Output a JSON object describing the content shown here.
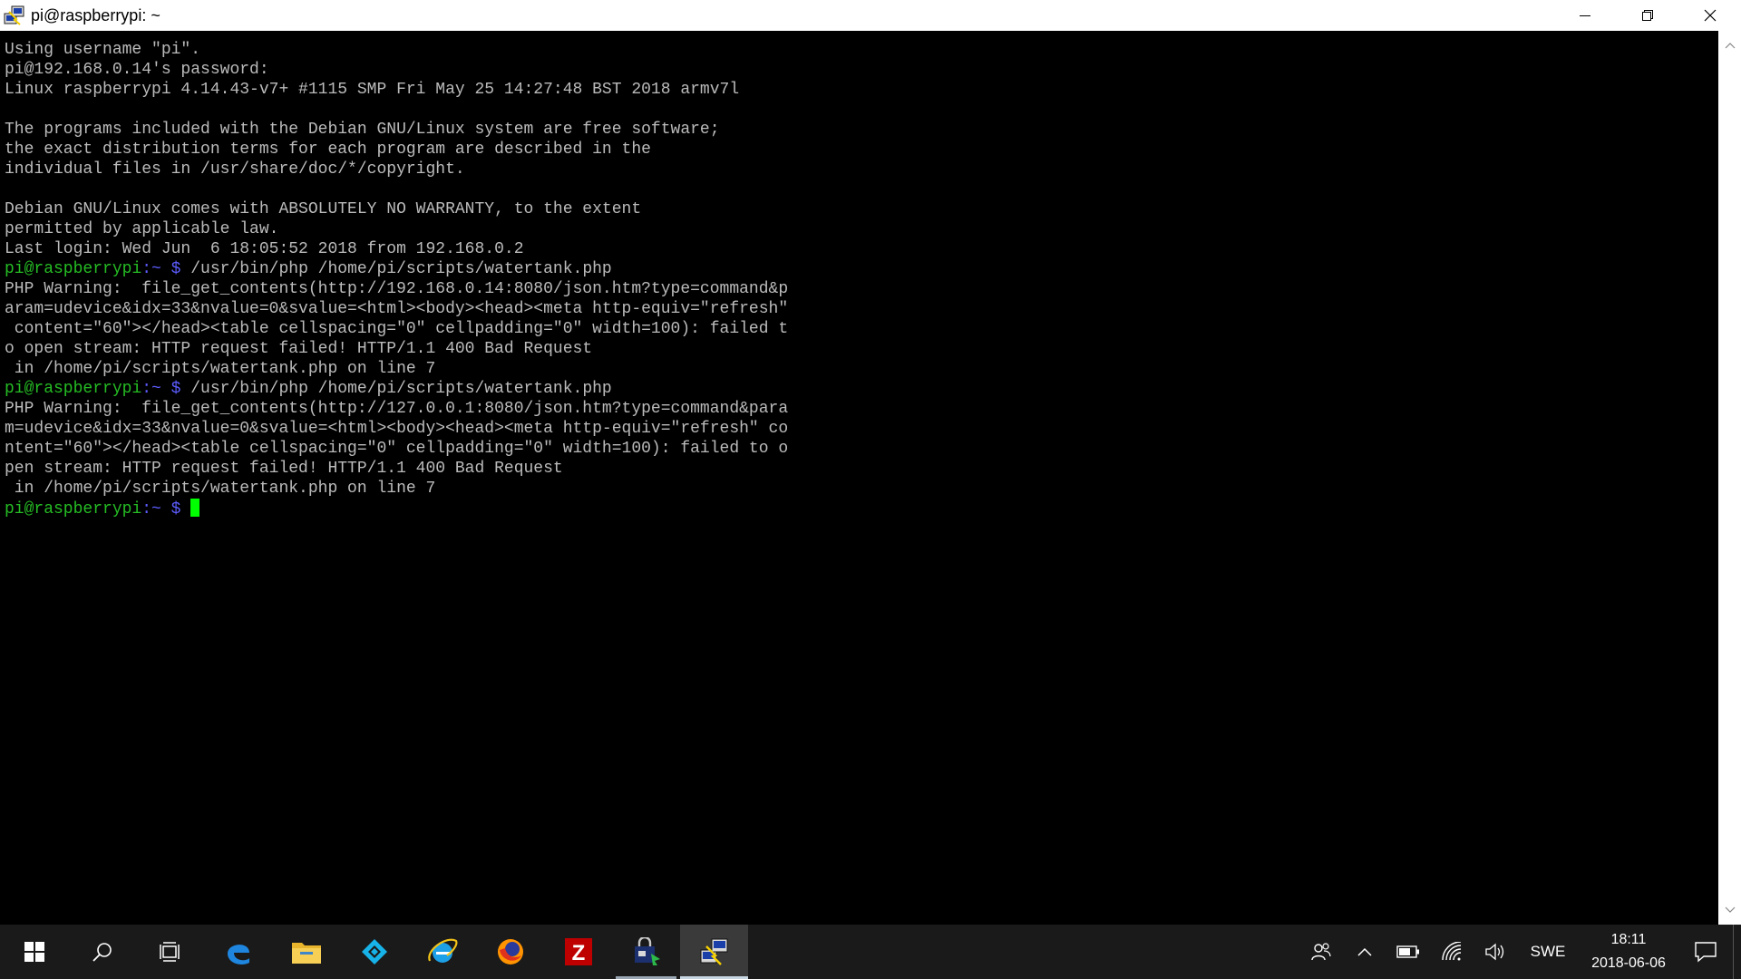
{
  "window": {
    "title": "pi@raspberrypi: ~"
  },
  "terminal": {
    "lines": [
      {
        "text": "Using username \"pi\"."
      },
      {
        "text": "pi@192.168.0.14's password:"
      },
      {
        "text": "Linux raspberrypi 4.14.43-v7+ #1115 SMP Fri May 25 14:27:48 BST 2018 armv7l"
      },
      {
        "text": ""
      },
      {
        "text": "The programs included with the Debian GNU/Linux system are free software;"
      },
      {
        "text": "the exact distribution terms for each program are described in the"
      },
      {
        "text": "individual files in /usr/share/doc/*/copyright."
      },
      {
        "text": ""
      },
      {
        "text": "Debian GNU/Linux comes with ABSOLUTELY NO WARRANTY, to the extent"
      },
      {
        "text": "permitted by applicable law."
      },
      {
        "text": "Last login: Wed Jun  6 18:05:52 2018 from 192.168.0.2"
      },
      {
        "prompt": "pi@raspberrypi",
        "path": ":~ $ ",
        "command": "/usr/bin/php /home/pi/scripts/watertank.php"
      },
      {
        "text": "PHP Warning:  file_get_contents(http://192.168.0.14:8080/json.htm?type=command&p"
      },
      {
        "text": "aram=udevice&idx=33&nvalue=0&svalue=<html><body><head><meta http-equiv=\"refresh\""
      },
      {
        "text": " content=\"60\"></head><table cellspacing=\"0\" cellpadding=\"0\" width=100): failed t"
      },
      {
        "text": "o open stream: HTTP request failed! HTTP/1.1 400 Bad Request"
      },
      {
        "text": " in /home/pi/scripts/watertank.php on line 7"
      },
      {
        "prompt": "pi@raspberrypi",
        "path": ":~ $ ",
        "command": "/usr/bin/php /home/pi/scripts/watertank.php"
      },
      {
        "text": "PHP Warning:  file_get_contents(http://127.0.0.1:8080/json.htm?type=command&para"
      },
      {
        "text": "m=udevice&idx=33&nvalue=0&svalue=<html><body><head><meta http-equiv=\"refresh\" co"
      },
      {
        "text": "ntent=\"60\"></head><table cellspacing=\"0\" cellpadding=\"0\" width=100): failed to o"
      },
      {
        "text": "pen stream: HTTP request failed! HTTP/1.1 400 Bad Request"
      },
      {
        "text": " in /home/pi/scripts/watertank.php on line 7"
      },
      {
        "prompt": "pi@raspberrypi",
        "path": ":~ $ ",
        "command": "",
        "cursor": true
      }
    ]
  },
  "taskbar": {
    "apps": [
      {
        "name": "start-button",
        "icon": "windows-logo-icon"
      },
      {
        "name": "search-button",
        "icon": "search-icon"
      },
      {
        "name": "task-view-button",
        "icon": "task-view-icon"
      },
      {
        "name": "taskbar-edge",
        "icon": "edge-icon"
      },
      {
        "name": "taskbar-file-explorer",
        "icon": "folder-icon"
      },
      {
        "name": "taskbar-kodi",
        "icon": "kodi-icon"
      },
      {
        "name": "taskbar-internet-explorer",
        "icon": "internet-explorer-icon"
      },
      {
        "name": "taskbar-firefox",
        "icon": "firefox-icon"
      },
      {
        "name": "taskbar-filezilla",
        "icon": "filezilla-icon",
        "glyph": "Z"
      },
      {
        "name": "taskbar-store-app",
        "icon": "store-lock-icon",
        "running": true
      },
      {
        "name": "taskbar-putty",
        "icon": "putty-icon",
        "active": true
      }
    ],
    "tray": {
      "language": "SWE",
      "time": "18:11",
      "date": "2018-06-06"
    }
  },
  "colors": {
    "terminal_bg": "#000000",
    "terminal_fg": "#bbbbbb",
    "prompt_green": "#25bc24",
    "prompt_blue": "#5c5cff",
    "cursor": "#00ff00",
    "taskbar_bg": "#1a1a1a"
  }
}
